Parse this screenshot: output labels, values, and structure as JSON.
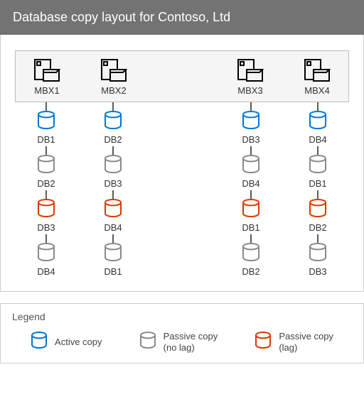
{
  "title": "Database copy layout for Contoso, Ltd",
  "colors": {
    "active": "#0078d4",
    "passive_nolag": "#8a8a8a",
    "passive_lag": "#d83b01",
    "server_stroke": "#000000"
  },
  "servers": [
    "MBX1",
    "MBX2",
    "MBX3",
    "MBX4"
  ],
  "columns": [
    [
      {
        "label": "DB1",
        "type": "active"
      },
      {
        "label": "DB2",
        "type": "passive_nolag"
      },
      {
        "label": "DB3",
        "type": "passive_lag"
      },
      {
        "label": "DB4",
        "type": "passive_nolag"
      }
    ],
    [
      {
        "label": "DB2",
        "type": "active"
      },
      {
        "label": "DB3",
        "type": "passive_nolag"
      },
      {
        "label": "DB4",
        "type": "passive_lag"
      },
      {
        "label": "DB1",
        "type": "passive_nolag"
      }
    ],
    [
      {
        "label": "DB3",
        "type": "active"
      },
      {
        "label": "DB4",
        "type": "passive_nolag"
      },
      {
        "label": "DB1",
        "type": "passive_lag"
      },
      {
        "label": "DB2",
        "type": "passive_nolag"
      }
    ],
    [
      {
        "label": "DB4",
        "type": "active"
      },
      {
        "label": "DB1",
        "type": "passive_nolag"
      },
      {
        "label": "DB2",
        "type": "passive_lag"
      },
      {
        "label": "DB3",
        "type": "passive_nolag"
      }
    ]
  ],
  "legend": {
    "heading": "Legend",
    "items": [
      {
        "type": "active",
        "text": "Active copy"
      },
      {
        "type": "passive_nolag",
        "text": "Passive copy\n(no lag)"
      },
      {
        "type": "passive_lag",
        "text": "Passive copy\n(lag)"
      }
    ]
  }
}
